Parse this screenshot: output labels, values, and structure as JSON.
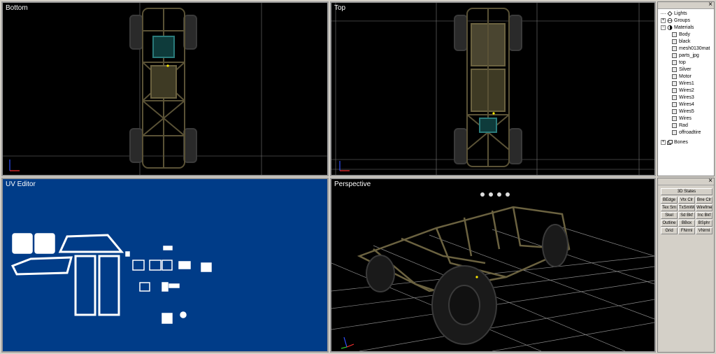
{
  "viewports": {
    "bottom": {
      "title": "Bottom"
    },
    "top": {
      "title": "Top"
    },
    "uv": {
      "title": "UV Editor"
    },
    "perspective": {
      "title": "Perspective"
    }
  },
  "scene_tree": {
    "lights": "Lights",
    "groups": "Groups",
    "materials": "Materials",
    "material_items": [
      "Body",
      "black",
      "mesh0130mat",
      "parts_jpg",
      "top",
      "Silver",
      "Motor",
      "Wires1",
      "Wires2",
      "Wires3",
      "Wires4",
      "Wires5",
      "Wires",
      "Rad",
      "offroadtire"
    ],
    "bones": "Bones"
  },
  "states_panel": {
    "header": "3D States",
    "buttons": [
      [
        "BEdge",
        "Vtx Clr",
        "Bne Clr"
      ],
      [
        "Tex Sm",
        "TxSmWr",
        "Wirefme"
      ],
      [
        "Skel",
        "Sd Bkf",
        "Inc Bkf"
      ],
      [
        "Outline",
        "BBox",
        "BSphr"
      ],
      [
        "Grid",
        "FNrml",
        "VNrml"
      ]
    ]
  },
  "close_glyph": "×",
  "colors": {
    "viewport_bg": "#000000",
    "uv_bg": "#003c88",
    "frame_color": "#5a5236",
    "grid_color": "#8a8a8a"
  }
}
